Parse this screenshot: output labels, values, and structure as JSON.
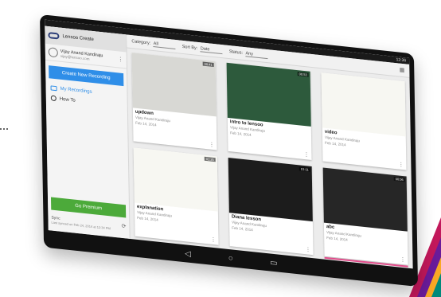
{
  "app": {
    "name": "Lensoo Create"
  },
  "user": {
    "name": "Vijay Anand Kandiraju",
    "email": "vijay@lensoo.com"
  },
  "sidebar": {
    "new_button": "Create New Recording",
    "items": [
      {
        "label": "My Recordings",
        "active": true
      },
      {
        "label": "How To",
        "active": false
      }
    ],
    "premium_button": "Go Premium",
    "sync_label": "Sync",
    "last_synced": "Last synced on Feb 24, 2014 at 12:34 PM"
  },
  "filters": {
    "category_label": "Category:",
    "category_value": "All",
    "sort_label": "Sort By:",
    "sort_value": "Date",
    "status_label": "Status:",
    "status_value": "Any"
  },
  "status_time": "12:36",
  "recordings": [
    {
      "title": "updown",
      "author": "Vijay Anand Kandiraju",
      "date": "Feb 14, 2014",
      "duration": "00:41",
      "thumb": "whiteboard"
    },
    {
      "title": "intro to lensoo",
      "author": "Vijay Anand Kandiraju",
      "date": "Feb 14, 2014",
      "duration": "00:53",
      "thumb": "greenboard"
    },
    {
      "title": "video",
      "author": "Vijay Anand Kandiraju",
      "date": "Feb 14, 2014",
      "duration": "",
      "thumb": "paper"
    },
    {
      "title": "explanation",
      "author": "Vijay Anand Kandiraju",
      "date": "Feb 14, 2014",
      "duration": "01:25",
      "thumb": "paper"
    },
    {
      "title": "Diana lesson",
      "author": "Vijay Anand Kandiraju",
      "date": "Feb 14, 2014",
      "duration": "01:11",
      "thumb": "blackboard"
    },
    {
      "title": "abc",
      "author": "Vijay Anand Kandiraju",
      "date": "Feb 14, 2014",
      "duration": "00:06",
      "thumb": "dark"
    }
  ],
  "colors": {
    "accent": "#2f8ee8",
    "premium": "#4caa3a",
    "progress": "#e24b8a"
  }
}
